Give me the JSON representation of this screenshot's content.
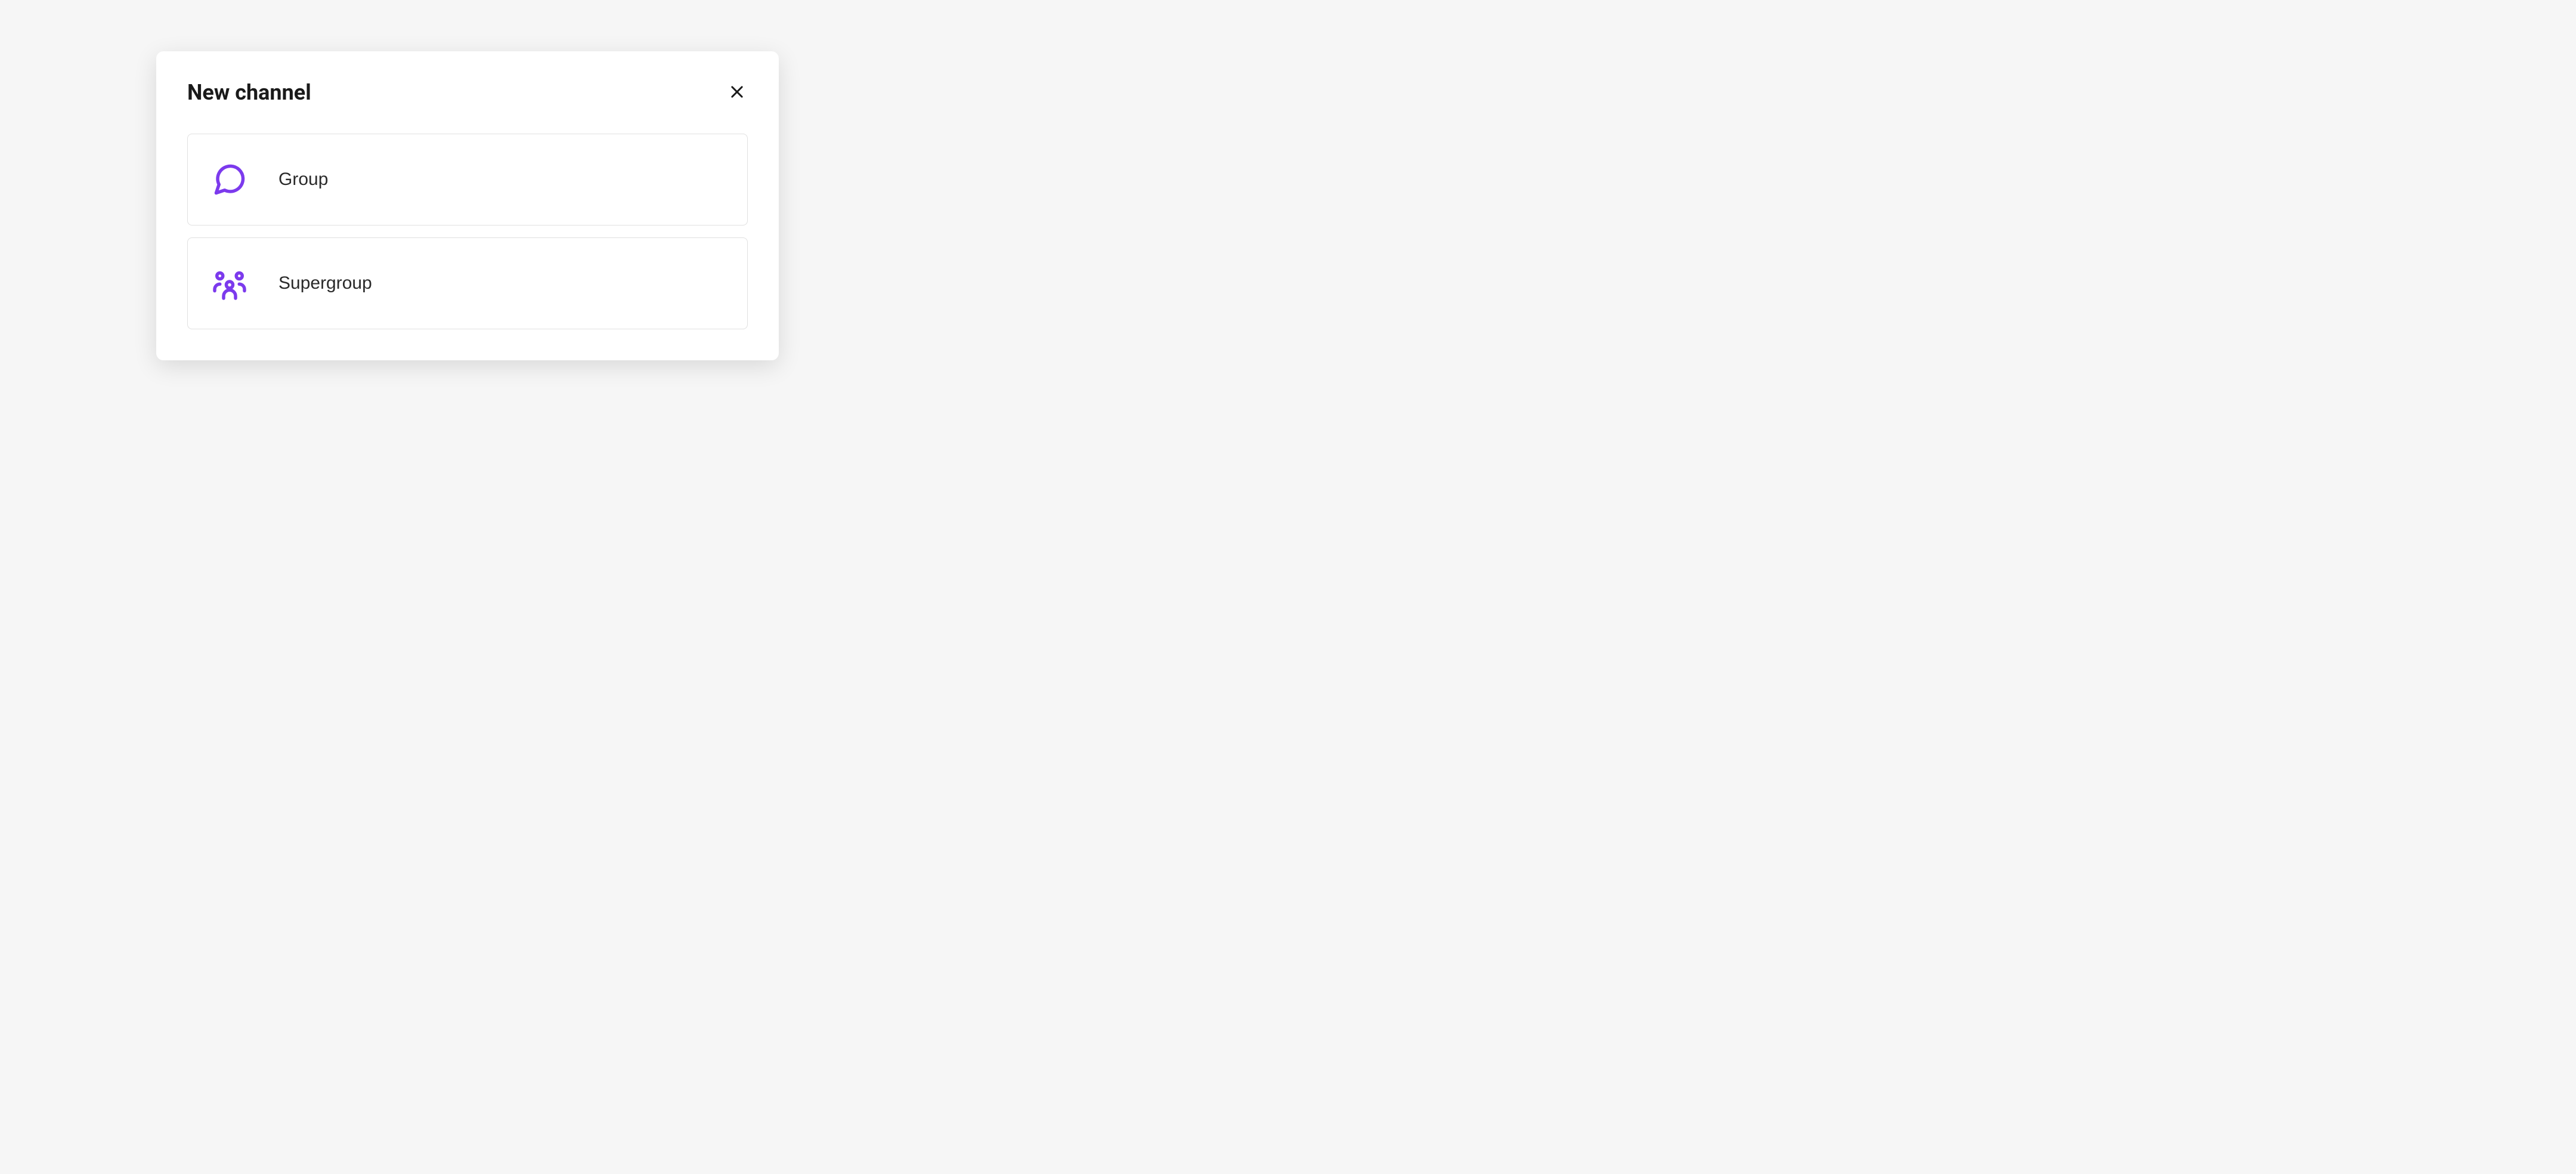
{
  "modal": {
    "title": "New channel",
    "options": [
      {
        "label": "Group",
        "icon": "speech-bubble"
      },
      {
        "label": "Supergroup",
        "icon": "users-group"
      }
    ]
  }
}
